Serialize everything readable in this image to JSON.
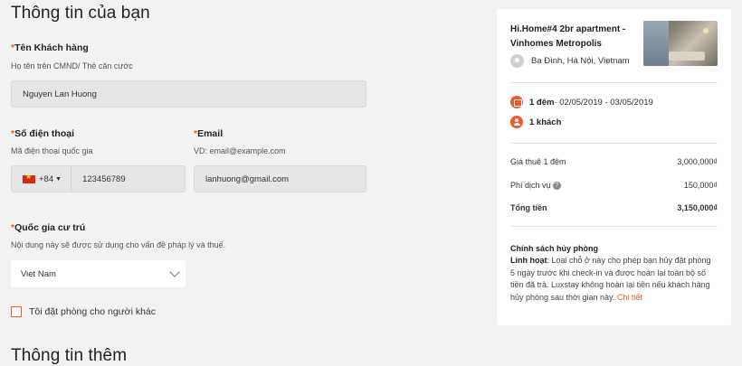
{
  "form": {
    "section_title": "Thông tin của bạn",
    "name": {
      "label": "Tên Khách hàng",
      "hint": "Họ tên trên CMND/ Thẻ căn cước",
      "value": "Nguyen Lan Huong"
    },
    "phone": {
      "label": "Số điện thoại",
      "hint": "Mã điện thoại quốc gia",
      "country_code": "+84",
      "value": "123456789",
      "flag_icon": "vietnam-flag-icon"
    },
    "email": {
      "label": "Email",
      "hint": "VD: email@example.com",
      "value": "lanhuong@gmail.com"
    },
    "country": {
      "label": "Quốc gia cư trú",
      "hint": "Nội dung này sẽ được sử dụng cho vấn đề pháp lý và thuế.",
      "selected": "Viet Nam"
    },
    "booking_for_other": {
      "label": "Tôi đặt phòng cho người khác",
      "checked": false
    },
    "more_title": "Thông tin thêm",
    "required_marker": "*"
  },
  "summary": {
    "listing_title": "Hi.Home#4 2br apartment - Vinhomes Metropolis",
    "location": "Ba Đình, Hà Nội, Vietnam",
    "nights": "1 đêm",
    "dates": " · 02/05/2019 - 03/05/2019",
    "guests": "1 khách",
    "price_rows": [
      {
        "label": "Giá thuê 1 đêm",
        "value": "3,000,000₫"
      },
      {
        "label": "Phí dịch vụ",
        "value": "150,000₫"
      },
      {
        "label": "Tổng tiền",
        "value": "3,150,000₫"
      }
    ],
    "policy": {
      "title": "Chính sách hủy phòng",
      "type": "Linh hoạt",
      "text": ": Loại chỗ ở này cho phép bạn hủy đặt phòng 5 ngày trước khi check-in và được hoàn lại toàn bộ số tiền đã trả. Luxstay không hoàn lại tiền nếu khách hàng hủy phòng sau thời gian này. ",
      "link": "Chi tiết"
    }
  },
  "colors": {
    "accent": "#f05a28",
    "background": "#f2f2f2",
    "input_bg": "#e6e6e6"
  }
}
